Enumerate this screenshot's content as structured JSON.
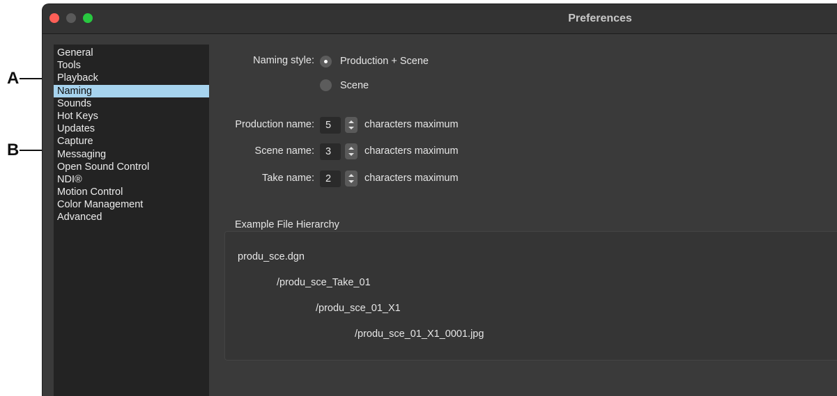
{
  "window": {
    "title": "Preferences"
  },
  "callouts": {
    "a": "A",
    "b": "B"
  },
  "sidebar": {
    "items": [
      {
        "label": "General"
      },
      {
        "label": "Tools"
      },
      {
        "label": "Playback"
      },
      {
        "label": "Naming",
        "selected": true
      },
      {
        "label": "Sounds"
      },
      {
        "label": "Hot Keys"
      },
      {
        "label": "Updates"
      },
      {
        "label": "Capture"
      },
      {
        "label": "Messaging"
      },
      {
        "label": "Open Sound Control"
      },
      {
        "label": "NDI®"
      },
      {
        "label": "Motion Control"
      },
      {
        "label": "Color Management"
      },
      {
        "label": "Advanced"
      }
    ]
  },
  "naming": {
    "style_label": "Naming style:",
    "style_options": [
      {
        "label": "Production + Scene",
        "selected": true
      },
      {
        "label": "Scene",
        "selected": false
      }
    ],
    "production_label": "Production name:",
    "production_value": "5",
    "scene_label": "Scene name:",
    "scene_value": "3",
    "take_label": "Take name:",
    "take_value": "2",
    "unit_text": "characters maximum"
  },
  "hierarchy": {
    "title": "Example File Hierarchy",
    "lines": [
      "produ_sce.dgn",
      "/produ_sce_Take_01",
      "/produ_sce_01_X1",
      "/produ_sce_01_X1_0001.jpg"
    ]
  },
  "colors": {
    "window_bg": "#3a3a3a",
    "sidebar_bg": "#232323",
    "selection": "#a6d3ee",
    "close": "#fe5f57",
    "maximize": "#28c840"
  }
}
